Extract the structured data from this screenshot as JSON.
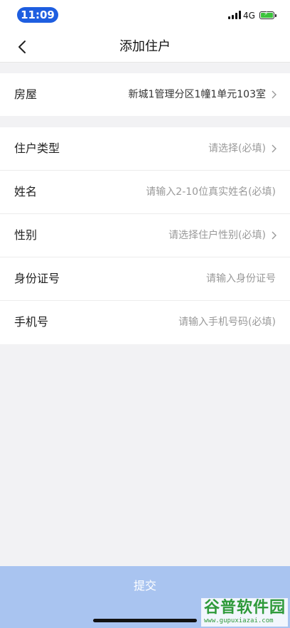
{
  "status_bar": {
    "time": "11:09",
    "network": "4G"
  },
  "nav": {
    "title": "添加住户"
  },
  "house": {
    "label": "房屋",
    "value": "新城1管理分区1幢1单元103室"
  },
  "form": {
    "resident_type": {
      "label": "住户类型",
      "placeholder": "请选择(必填)"
    },
    "name": {
      "label": "姓名",
      "placeholder": "请输入2-10位真实姓名(必填)"
    },
    "gender": {
      "label": "性别",
      "placeholder": "请选择住户性别(必填)"
    },
    "id_number": {
      "label": "身份证号",
      "placeholder": "请输入身份证号"
    },
    "phone": {
      "label": "手机号",
      "placeholder": "请输入手机号码(必填)"
    }
  },
  "submit": {
    "label": "提交"
  },
  "watermark": {
    "title": "谷普软件园",
    "url": "www.gupuxiazai.com"
  },
  "colors": {
    "accent": "#1e5ee0",
    "submit_bg": "#a9c4f0",
    "battery": "#3cc33c"
  },
  "icons": [
    "back-arrow-icon",
    "chevron-right-icon",
    "signal-icon",
    "battery-icon"
  ]
}
